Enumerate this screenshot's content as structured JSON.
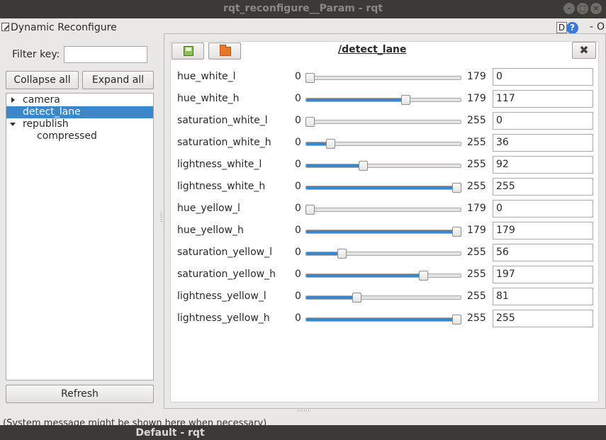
{
  "window": {
    "title": "rqt_reconfigure__Param - rqt",
    "controls": [
      "-",
      "□",
      "×"
    ]
  },
  "plugin": {
    "title": "Dynamic Reconfigure",
    "d_label": "D",
    "help_label": "?",
    "minimize_label": "-",
    "close_label": "O"
  },
  "filter": {
    "label": "Filter key:",
    "value": ""
  },
  "buttons": {
    "collapse_all": "Collapse all",
    "expand_all": "Expand all",
    "refresh": "Refresh"
  },
  "tree": [
    {
      "label": "camera",
      "level": 0,
      "expander": "collapsed",
      "selected": false
    },
    {
      "label": "detect_lane",
      "level": 0,
      "expander": "none",
      "selected": true
    },
    {
      "label": "republish",
      "level": 0,
      "expander": "expanded",
      "selected": false
    },
    {
      "label": "compressed",
      "level": 1,
      "expander": "none",
      "selected": false
    }
  ],
  "node": {
    "title": "/detect_lane",
    "close_label": "✖"
  },
  "params": [
    {
      "name": "hue_white_l",
      "min": 0,
      "max": 179,
      "value": 0
    },
    {
      "name": "hue_white_h",
      "min": 0,
      "max": 179,
      "value": 117
    },
    {
      "name": "saturation_white_l",
      "min": 0,
      "max": 255,
      "value": 0
    },
    {
      "name": "saturation_white_h",
      "min": 0,
      "max": 255,
      "value": 36
    },
    {
      "name": "lightness_white_l",
      "min": 0,
      "max": 255,
      "value": 92
    },
    {
      "name": "lightness_white_h",
      "min": 0,
      "max": 255,
      "value": 255
    },
    {
      "name": "hue_yellow_l",
      "min": 0,
      "max": 179,
      "value": 0
    },
    {
      "name": "hue_yellow_h",
      "min": 0,
      "max": 179,
      "value": 179
    },
    {
      "name": "saturation_yellow_l",
      "min": 0,
      "max": 255,
      "value": 56
    },
    {
      "name": "saturation_yellow_h",
      "min": 0,
      "max": 255,
      "value": 197
    },
    {
      "name": "lightness_yellow_l",
      "min": 0,
      "max": 255,
      "value": 81
    },
    {
      "name": "lightness_yellow_h",
      "min": 0,
      "max": 255,
      "value": 255
    }
  ],
  "status": {
    "message": "(System message might be shown here when necessary)"
  },
  "taskbar": {
    "tab": "Default - rqt"
  },
  "colors": {
    "accent": "#3b87c9",
    "titlebar": "#3b3a36",
    "background": "#e9e8e6"
  }
}
